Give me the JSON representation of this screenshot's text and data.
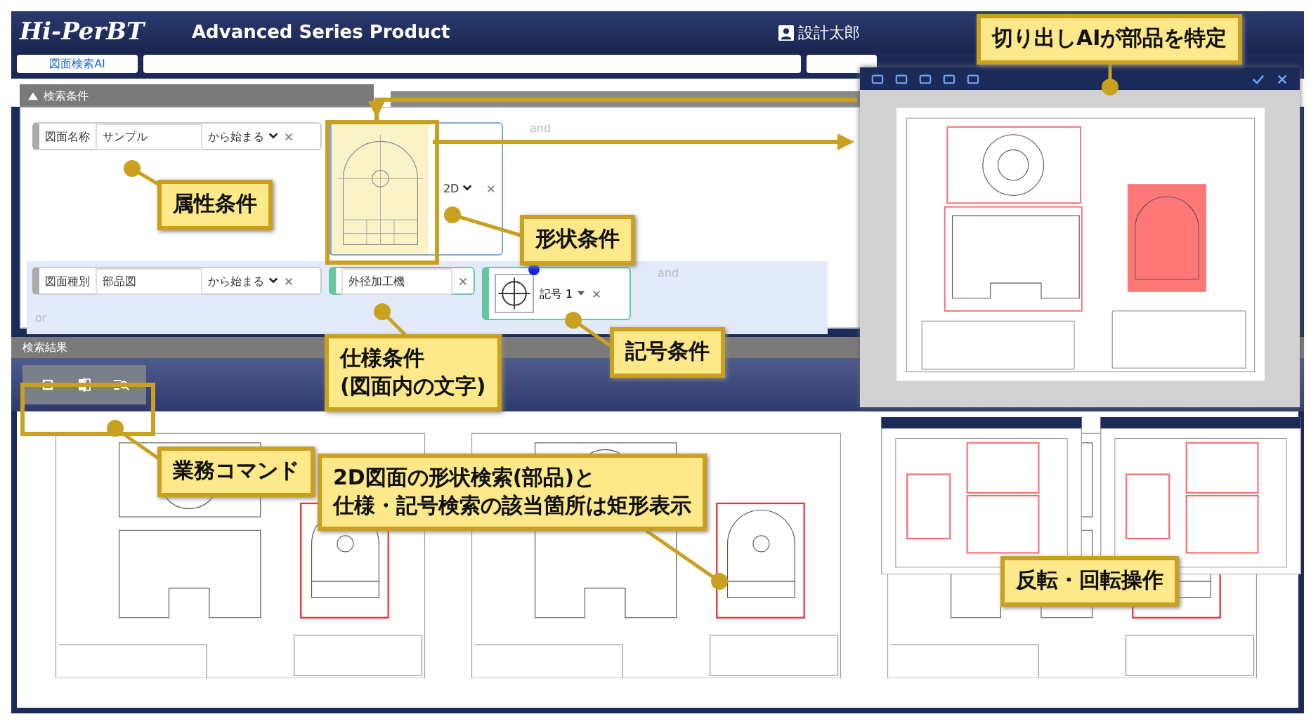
{
  "header": {
    "logo": "Hi-PerBT",
    "title": "Advanced Series Product",
    "user": "設計太郎"
  },
  "tabs": [
    {
      "label": "図面検索AI",
      "selected": true
    }
  ],
  "conditions": {
    "title": "検索条件",
    "expanded": true,
    "or_label": "or",
    "groups": [
      {
        "connector": "and",
        "highlighted": false,
        "items": [
          {
            "kind": "attribute",
            "label": "図面名称",
            "value": "サンプル",
            "match": "から始まる"
          },
          {
            "kind": "shape",
            "mode": "2D"
          }
        ]
      },
      {
        "connector": "and",
        "highlighted": true,
        "items": [
          {
            "kind": "attribute",
            "label": "図面種別",
            "value": "部品図",
            "match": "から始まる"
          },
          {
            "kind": "text",
            "value": "外径加工機"
          },
          {
            "kind": "symbol",
            "value": "記号 1"
          }
        ]
      }
    ]
  },
  "results": {
    "title": "検索結果"
  },
  "callouts": [
    {
      "lines": [
        "属性条件"
      ]
    },
    {
      "lines": [
        "形状条件"
      ]
    },
    {
      "lines": [
        "仕様条件",
        "(図面内の文字)"
      ]
    },
    {
      "lines": [
        "記号条件"
      ]
    },
    {
      "lines": [
        "業務コマンド"
      ]
    },
    {
      "lines": [
        "2D図面の形状検索(部品)と",
        "仕様・記号検索の該当箇所は矩形表示"
      ]
    },
    {
      "lines": [
        "切り出しAIが部品を特定"
      ]
    },
    {
      "lines": [
        "反転・回転操作"
      ]
    }
  ]
}
